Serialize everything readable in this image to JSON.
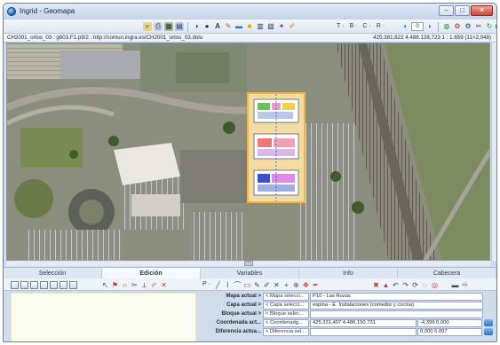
{
  "window": {
    "title": "Ingrid - Geomapa",
    "buttons": [
      "–",
      "□",
      "✕"
    ]
  },
  "toolbar": {
    "drop_t": "T ·",
    "drop_b": "B ·",
    "drop_c": "C ·",
    "drop_r": "R ·",
    "zoom_value": "0"
  },
  "pathbar": {
    "path": "CH2001_ortos_03 : g603.F1.p9/2 : http://comun.ingra.es/CH2001_ortos_03.dolu",
    "coords": "425.381,622  4.486.128,723  1 : 1.659 (11×2,048)"
  },
  "tabs": [
    {
      "label": "Selección",
      "active": false
    },
    {
      "label": "Edición",
      "active": true
    },
    {
      "label": "Variables",
      "active": false
    },
    {
      "label": "Info",
      "active": false
    },
    {
      "label": "Cabecera",
      "active": false
    }
  ],
  "edit_toolbar": {
    "p_label": "P ·"
  },
  "form": {
    "rows": [
      {
        "label": "Mapa actual >",
        "select": "< Mapa selecci...",
        "value": "P10 - Las Rozas",
        "extra": "",
        "extra2": ""
      },
      {
        "label": "Capa actual >",
        "select": "< Capa selecci...",
        "value": "espina - E. Instalaciones (comedor y cocina)",
        "extra": "",
        "extra2": ""
      },
      {
        "label": "Bloque actual >",
        "select": "< Bloque selec...",
        "value": "",
        "extra": "",
        "extra2": ""
      },
      {
        "label": "Coordenada act...",
        "select": "< Coordenadg...",
        "value": "425.331,407  4.486.150,731",
        "extra": "-4,399  0,000",
        "extra2": ""
      },
      {
        "label": "Diferencia actua...",
        "select": "< Diferencia sel...",
        "value": "",
        "extra": "0,000  6,097",
        "extra2": ""
      }
    ]
  },
  "colors": {
    "titlebar": "#c4d4e9",
    "map_overlay_frame": "#f5b342",
    "active_tab": "#f6f9fd"
  }
}
